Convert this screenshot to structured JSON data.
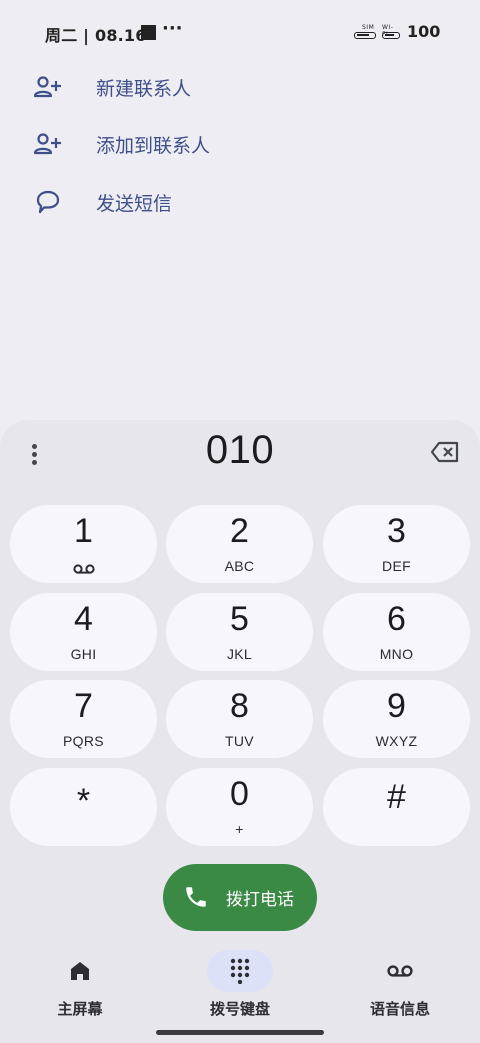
{
  "status_bar": {
    "time": "周二 | 08.16",
    "overflow": "···",
    "sim_label": "SIM",
    "wifi_label": "WI-FI",
    "battery": "100"
  },
  "suggestions": [
    {
      "label": "新建联系人",
      "icon": "person-add-icon"
    },
    {
      "label": "添加到联系人",
      "icon": "person-add-icon"
    },
    {
      "label": "发送短信",
      "icon": "message-bubble-icon"
    }
  ],
  "dialer": {
    "number": "010",
    "keys": [
      {
        "digit": "1",
        "letters": ""
      },
      {
        "digit": "2",
        "letters": "ABC"
      },
      {
        "digit": "3",
        "letters": "DEF"
      },
      {
        "digit": "4",
        "letters": "GHI"
      },
      {
        "digit": "5",
        "letters": "JKL"
      },
      {
        "digit": "6",
        "letters": "MNO"
      },
      {
        "digit": "7",
        "letters": "PQRS"
      },
      {
        "digit": "8",
        "letters": "TUV"
      },
      {
        "digit": "9",
        "letters": "WXYZ"
      },
      {
        "digit": "*",
        "letters": ""
      },
      {
        "digit": "0",
        "letters": "+"
      },
      {
        "digit": "#",
        "letters": ""
      }
    ],
    "call_label": "拨打电话"
  },
  "nav": {
    "items": [
      {
        "label": "主屏幕",
        "icon": "home-icon",
        "active": false
      },
      {
        "label": "拨号键盘",
        "icon": "dialpad-icon",
        "active": true
      },
      {
        "label": "语音信息",
        "icon": "voicemail-icon",
        "active": false
      }
    ]
  },
  "colors": {
    "background": "#eeedf3",
    "sheet": "#e7e6ec",
    "key": "#f8f6fd",
    "accent_text": "#3f4f8a",
    "call_button": "#3a8a46",
    "nav_active": "#dde1f7"
  }
}
